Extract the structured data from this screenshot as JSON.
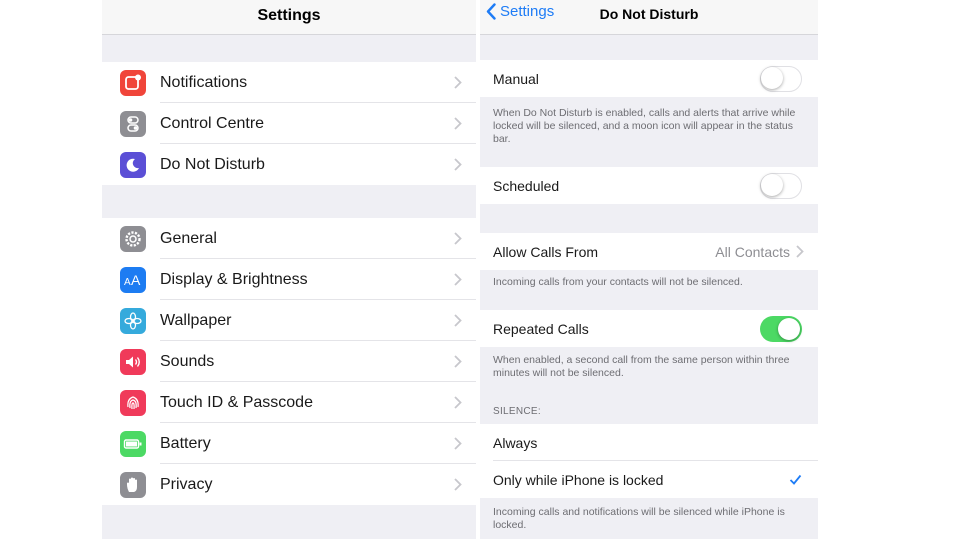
{
  "left": {
    "title": "Settings",
    "group1": [
      {
        "label": "Notifications",
        "icon": "notifications-icon",
        "color": "#f0453a"
      },
      {
        "label": "Control Centre",
        "icon": "control-centre-icon",
        "color": "#8e8e93"
      },
      {
        "label": "Do Not Disturb",
        "icon": "moon-icon",
        "color": "#5b4fd6"
      }
    ],
    "group2": [
      {
        "label": "General",
        "icon": "gear-icon",
        "color": "#8e8e93"
      },
      {
        "label": "Display & Brightness",
        "icon": "display-brightness-icon",
        "color": "#1d7cf2"
      },
      {
        "label": "Wallpaper",
        "icon": "wallpaper-icon",
        "color": "#35aadc"
      },
      {
        "label": "Sounds",
        "icon": "speaker-icon",
        "color": "#f03a5a"
      },
      {
        "label": "Touch ID & Passcode",
        "icon": "fingerprint-icon",
        "color": "#f03a5a"
      },
      {
        "label": "Battery",
        "icon": "battery-icon",
        "color": "#4cd964"
      },
      {
        "label": "Privacy",
        "icon": "hand-icon",
        "color": "#8e8e93"
      }
    ]
  },
  "right": {
    "back_label": "Settings",
    "title": "Do Not Disturb",
    "manual": {
      "label": "Manual",
      "on": false
    },
    "manual_note": "When Do Not Disturb is enabled, calls and alerts that arrive while locked will be silenced, and a moon icon will appear in the status bar.",
    "scheduled": {
      "label": "Scheduled",
      "on": false
    },
    "allow_calls": {
      "label": "Allow Calls From",
      "value": "All Contacts"
    },
    "allow_note": "Incoming calls from your contacts will not be silenced.",
    "repeated": {
      "label": "Repeated Calls",
      "on": true
    },
    "repeated_note": "When enabled, a second call from the same person within three minutes will not be silenced.",
    "silence_header": "SILENCE:",
    "silence_options": [
      {
        "label": "Always",
        "selected": false
      },
      {
        "label": "Only while iPhone is locked",
        "selected": true
      }
    ],
    "silence_note": "Incoming calls and notifications will be silenced while iPhone is locked."
  },
  "colors": {
    "accent": "#1e7cf6",
    "toggle_on": "#4cd964"
  }
}
